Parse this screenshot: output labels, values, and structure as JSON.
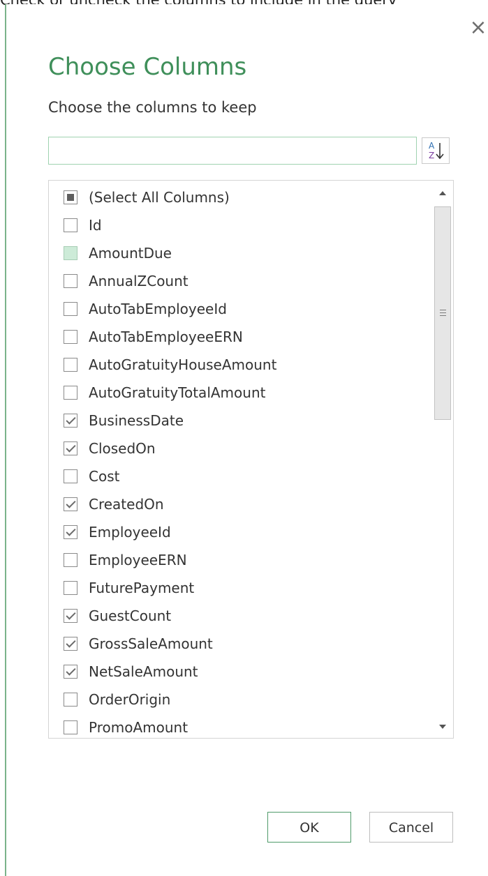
{
  "caption": "Check or uncheck the columns to include in the query",
  "dialog": {
    "close_glyph": "×",
    "title": "Choose Columns",
    "subtitle": "Choose the columns to keep",
    "search": {
      "value": "",
      "placeholder": ""
    },
    "sort_icon": "sort-az-icon",
    "ok_label": "OK",
    "cancel_label": "Cancel"
  },
  "columns": [
    {
      "label": "(Select All Columns)",
      "state": "indeterminate"
    },
    {
      "label": "Id",
      "state": "unchecked"
    },
    {
      "label": "AmountDue",
      "state": "hover"
    },
    {
      "label": "AnnualZCount",
      "state": "unchecked"
    },
    {
      "label": "AutoTabEmployeeId",
      "state": "unchecked"
    },
    {
      "label": "AutoTabEmployeeERN",
      "state": "unchecked"
    },
    {
      "label": "AutoGratuityHouseAmount",
      "state": "unchecked"
    },
    {
      "label": "AutoGratuityTotalAmount",
      "state": "unchecked"
    },
    {
      "label": "BusinessDate",
      "state": "checked"
    },
    {
      "label": "ClosedOn",
      "state": "checked"
    },
    {
      "label": "Cost",
      "state": "unchecked"
    },
    {
      "label": "CreatedOn",
      "state": "checked"
    },
    {
      "label": "EmployeeId",
      "state": "checked"
    },
    {
      "label": "EmployeeERN",
      "state": "unchecked"
    },
    {
      "label": "FuturePayment",
      "state": "unchecked"
    },
    {
      "label": "GuestCount",
      "state": "checked"
    },
    {
      "label": "GrossSaleAmount",
      "state": "checked"
    },
    {
      "label": "NetSaleAmount",
      "state": "checked"
    },
    {
      "label": "OrderOrigin",
      "state": "unchecked"
    },
    {
      "label": "PromoAmount",
      "state": "unchecked"
    }
  ],
  "colors": {
    "accent": "#3f8f5a",
    "border_green": "#7ab38a",
    "hover_fill": "#cdebd8"
  }
}
